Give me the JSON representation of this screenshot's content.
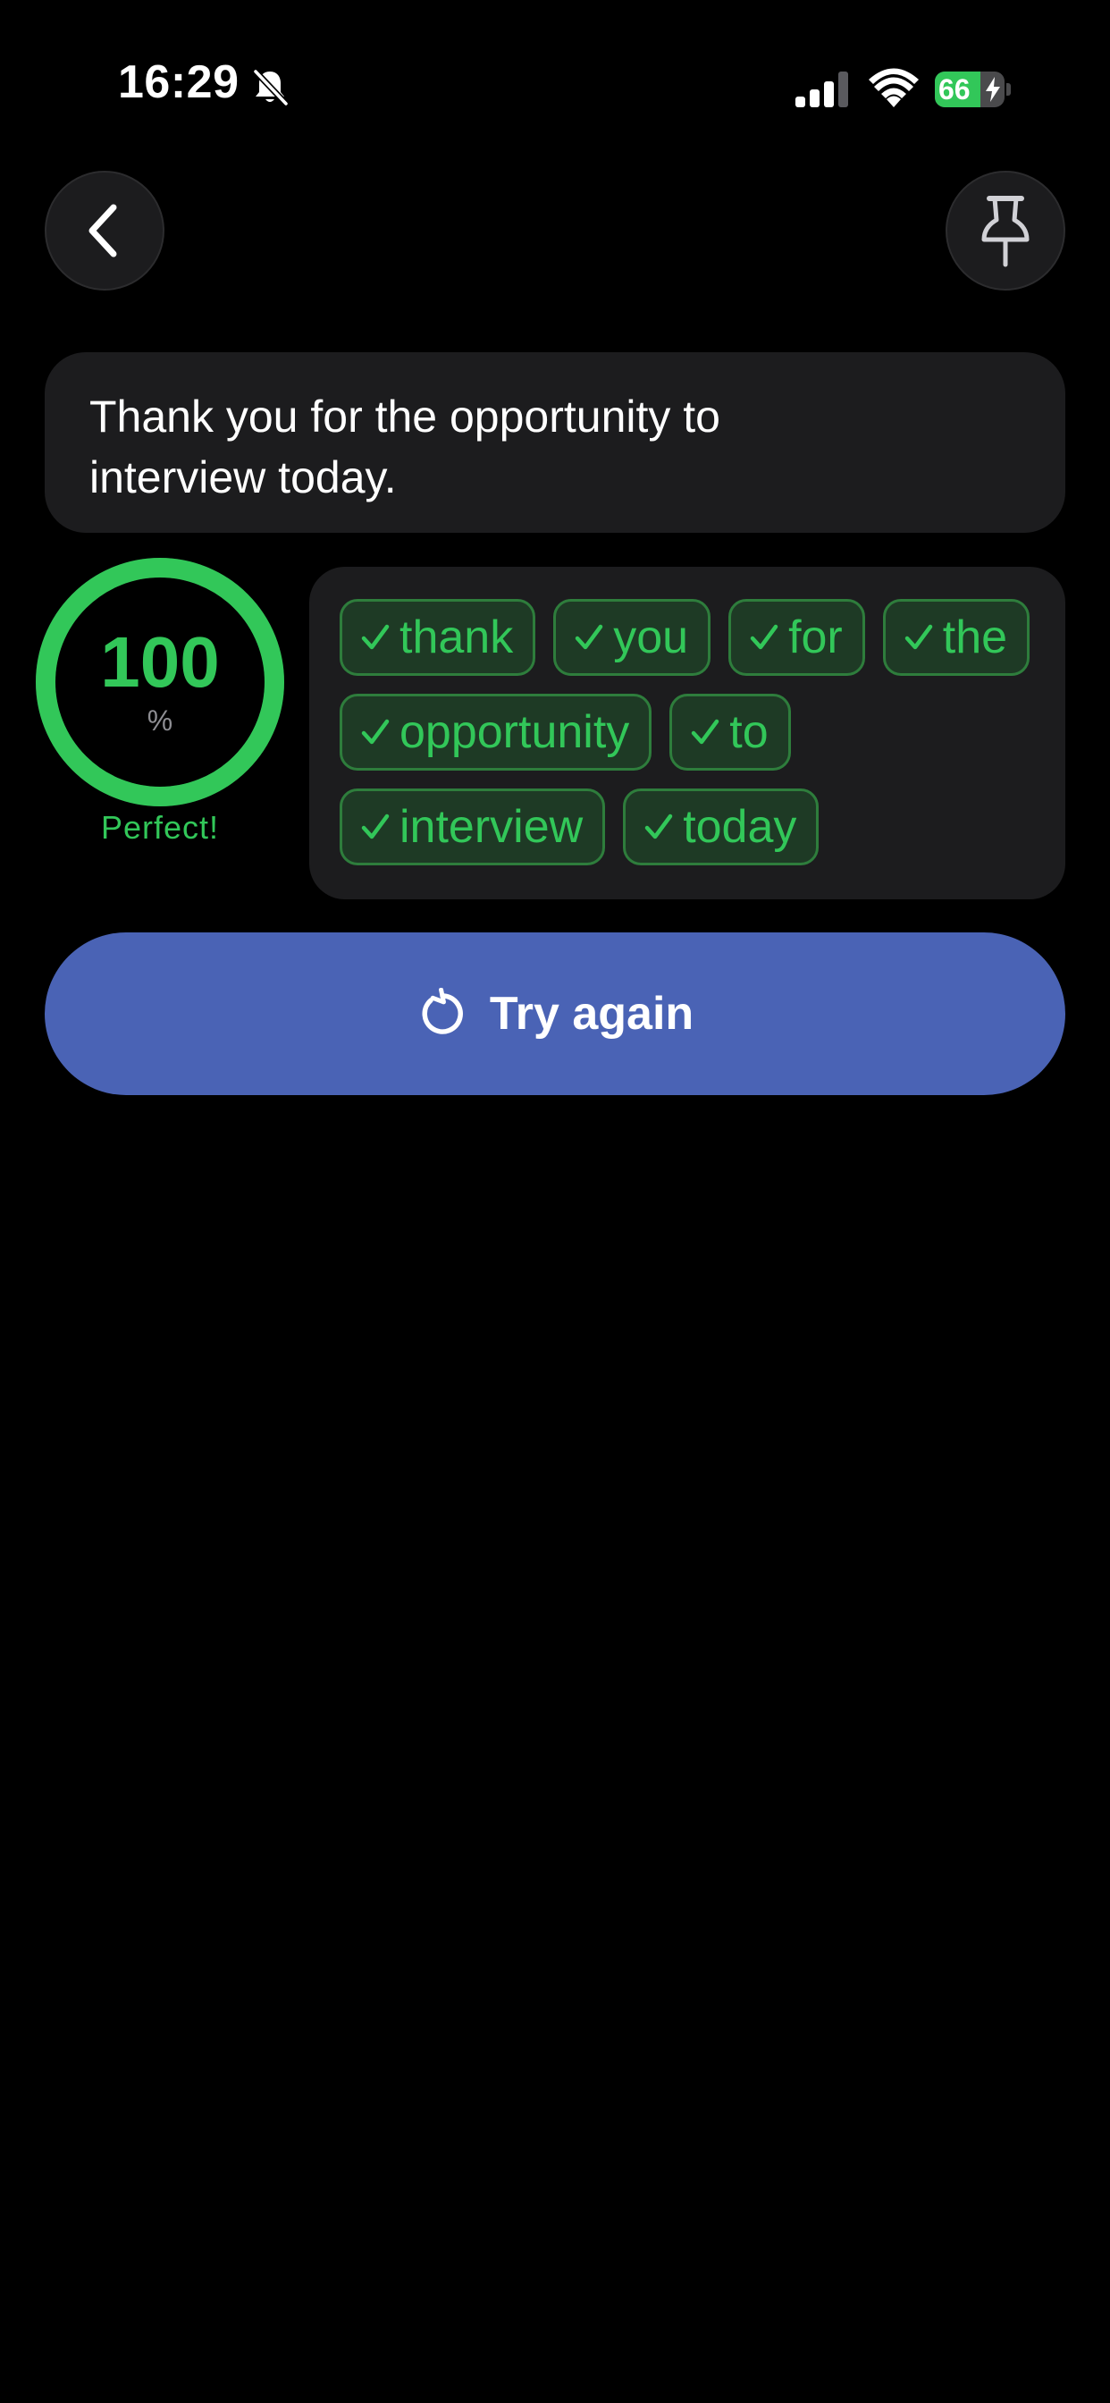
{
  "status_bar": {
    "time": "16:29",
    "battery_level": "66",
    "battery_percent": 66,
    "icons": [
      "bell-slash-icon",
      "cellular-signal-icon",
      "wifi-icon",
      "battery-icon",
      "charging-bolt-icon"
    ]
  },
  "header": {
    "back_icon": "chevron-left-icon",
    "pin_icon": "pin-icon"
  },
  "sentence": {
    "text": "Thank you for the opportunity to interview today."
  },
  "score": {
    "value": "100",
    "unit": "%",
    "label": "Perfect!",
    "fraction": 1.0
  },
  "words": [
    {
      "text": "thank",
      "status": "correct"
    },
    {
      "text": "you",
      "status": "correct"
    },
    {
      "text": "for",
      "status": "correct"
    },
    {
      "text": "the",
      "status": "correct"
    },
    {
      "text": "opportunity",
      "status": "correct"
    },
    {
      "text": "to",
      "status": "correct"
    },
    {
      "text": "interview",
      "status": "correct"
    },
    {
      "text": "today",
      "status": "correct"
    }
  ],
  "actions": {
    "try_again_label": "Try again",
    "try_again_icon": "retry-icon"
  },
  "colors": {
    "background": "#000000",
    "card": "#1c1c1e",
    "success_green": "#32c759",
    "chip_background": "#1e3a25",
    "chip_border": "#2e7d3c",
    "primary_button": "#4a63b5"
  }
}
